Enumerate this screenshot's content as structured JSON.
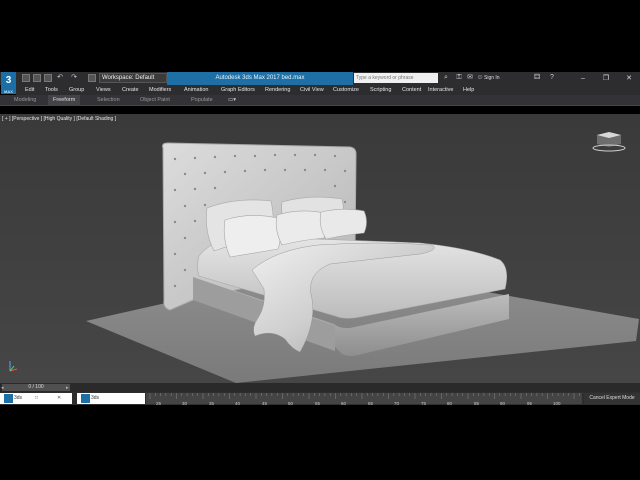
{
  "app": {
    "logo_label": "3",
    "logo_sub": "MAX",
    "workspace": "Workspace: Default",
    "title": "Autodesk 3ds Max 2017    bed.max",
    "search_placeholder": "Type a keyword or phrase",
    "signin": "Sign In"
  },
  "menu": [
    "Edit",
    "Tools",
    "Group",
    "Views",
    "Create",
    "Modifiers",
    "Animation",
    "Graph Editors",
    "Rendering",
    "Civil View",
    "Customize",
    "Scripting",
    "Content",
    "Interactive",
    "Help"
  ],
  "ribbon": {
    "tabs": [
      "Modeling",
      "Freeform",
      "Selection",
      "Object Paint",
      "Populate"
    ],
    "active": "Freeform"
  },
  "viewport": {
    "label": "[ + ] [Perspective ] [High Quality ] [Default Shading ]"
  },
  "timeline": {
    "frame_counter": "0 / 100",
    "ticks": [
      "25",
      "30",
      "35",
      "40",
      "45",
      "50",
      "55",
      "60",
      "65",
      "70",
      "75",
      "80",
      "85",
      "90",
      "95",
      "100"
    ]
  },
  "status": {
    "tab1": "3ds",
    "tab2": "3ds",
    "cancel_expert": "Cancel Expert Mode"
  },
  "colors": {
    "accent": "#1d6fa5",
    "viewport_bg": "#404040"
  }
}
